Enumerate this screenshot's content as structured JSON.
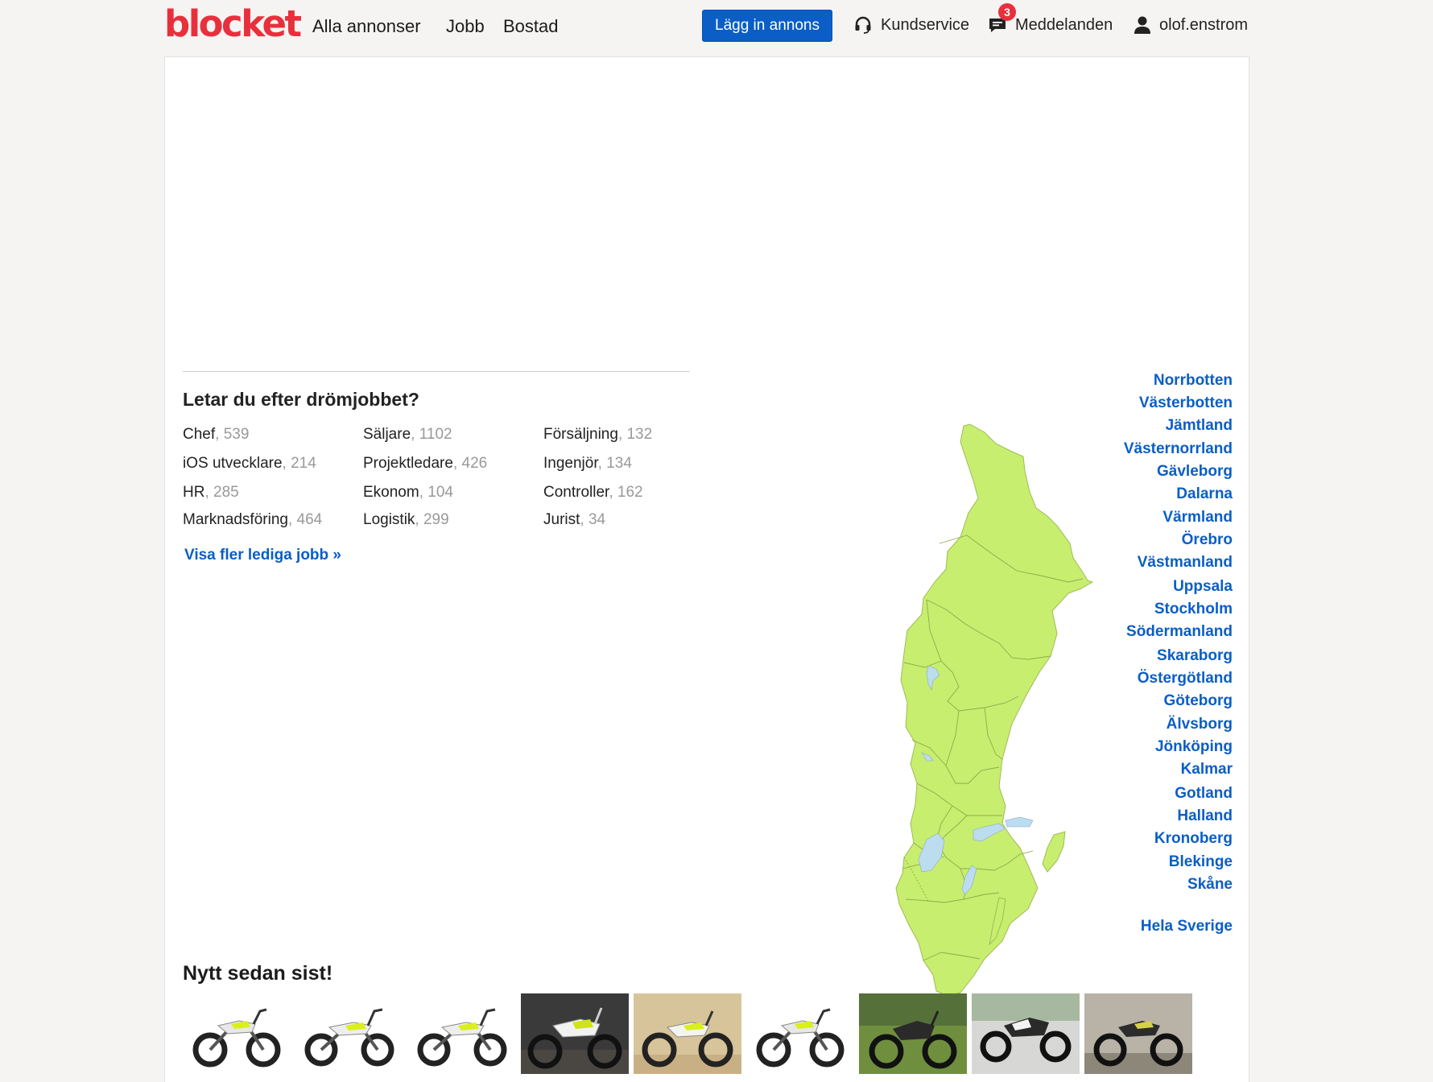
{
  "header": {
    "logo": "blocket",
    "nav": [
      {
        "label": "Alla annonser"
      },
      {
        "label": "Jobb"
      },
      {
        "label": "Bostad"
      }
    ],
    "post_button": "Lägg in annons",
    "customer_service": "Kundservice",
    "messages": "Meddelanden",
    "messages_count": "3",
    "username": "olof.enstrom"
  },
  "jobs": {
    "title": "Letar du efter drömjobbet?",
    "items": [
      {
        "label": "Chef",
        "count": ", 539"
      },
      {
        "label": "Säljare",
        "count": ", 1102"
      },
      {
        "label": "Försäljning",
        "count": ", 132"
      },
      {
        "label": "iOS utvecklare",
        "count": ", 214"
      },
      {
        "label": "Projektledare",
        "count": ", 426"
      },
      {
        "label": "Ingenjör",
        "count": ", 134"
      },
      {
        "label": "HR",
        "count": ", 285"
      },
      {
        "label": "Ekonom",
        "count": ", 104"
      },
      {
        "label": "Controller",
        "count": ", 162"
      },
      {
        "label": "Marknadsföring",
        "count": ", 464"
      },
      {
        "label": "Logistik",
        "count": ", 299"
      },
      {
        "label": "Jurist",
        "count": ", 34"
      }
    ],
    "more_link": "Visa fler lediga jobb »"
  },
  "regions": [
    "Norrbotten",
    "Västerbotten",
    "Jämtland",
    "Västernorrland",
    "Gävleborg",
    "Dalarna",
    "Värmland",
    "Örebro",
    "Västmanland",
    "Uppsala",
    "Stockholm",
    "Södermanland",
    "Skaraborg",
    "Östergötland",
    "Göteborg",
    "Älvsborg",
    "Jönköping",
    "Kalmar",
    "Gotland",
    "Halland",
    "Kronoberg",
    "Blekinge",
    "Skåne"
  ],
  "all_sweden": "Hela Sverige",
  "new_section": {
    "title": "Nytt sedan sist!",
    "thumbnails": [
      {
        "icon": "motorcycle-white-bg"
      },
      {
        "icon": "motorcycle-white-bg"
      },
      {
        "icon": "motorcycle-white-bg"
      },
      {
        "icon": "motorcycle-dark-bg"
      },
      {
        "icon": "motorcycle-tan-bg"
      },
      {
        "icon": "motorcycle-white-bg"
      },
      {
        "icon": "motorcycle-grass-bg"
      },
      {
        "icon": "motorcycle-road-bg"
      },
      {
        "icon": "motorcycle-garage-bg"
      }
    ]
  },
  "colors": {
    "brand": "#e8303c",
    "link": "#0a5ec6",
    "map_fill": "#c7ee6e",
    "lake": "#bcdcf0"
  }
}
